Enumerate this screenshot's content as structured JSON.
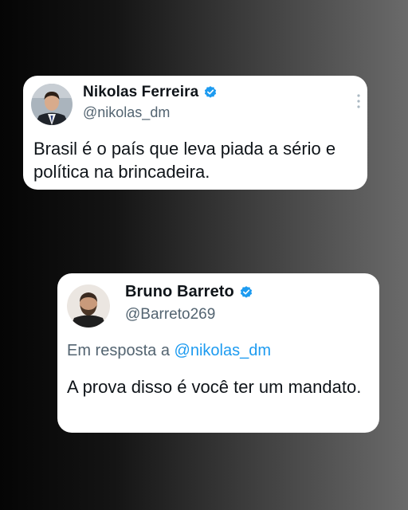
{
  "tweet1": {
    "display_name": "Nikolas Ferreira",
    "handle": "@nikolas_dm",
    "text": "Brasil é o país que leva piada a sério e política na brincadeira.",
    "verified": true,
    "avatar_icon": "user-avatar-suit",
    "menu_icon": "more-options-icon"
  },
  "tweet2": {
    "display_name": "Bruno Barreto",
    "handle": "@Barreto269",
    "reply_prefix": "Em resposta a",
    "reply_to": "@nikolas_dm",
    "text": "A prova disso é você ter um mandato.",
    "verified": true,
    "avatar_icon": "user-avatar-beard"
  },
  "colors": {
    "verified_blue": "#1d9bf0",
    "mention_blue": "#1d9bf0",
    "handle_gray": "#536471",
    "text_dark": "#0f1419",
    "card_bg": "#ffffff"
  }
}
